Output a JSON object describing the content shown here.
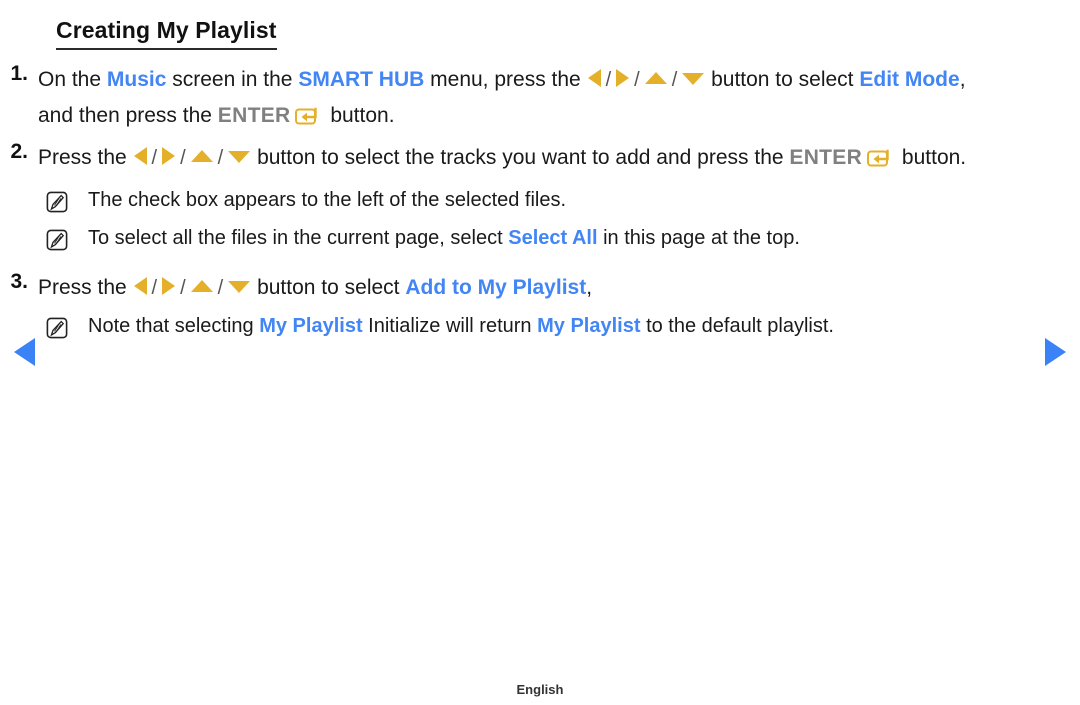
{
  "page": {
    "title": "Creating My Playlist",
    "language_footer": "English"
  },
  "nav": {
    "prev_label": "previous-page",
    "next_label": "next-page"
  },
  "icons": {
    "dpad_left": "arrow-left-icon",
    "dpad_right": "arrow-right-icon",
    "dpad_up": "arrow-up-icon",
    "dpad_down": "arrow-down-icon",
    "enter_key": "enter-key-icon",
    "note": "note-pencil-icon",
    "nav_prev": "nav-prev-arrow-icon",
    "nav_next": "nav-next-arrow-icon"
  },
  "colors": {
    "accent_blue": "#4285f4",
    "nav_blue": "#3b82f6",
    "amber": "#e4b02a",
    "gray_label": "#808080",
    "body_text": "#1a1a1a"
  },
  "steps": [
    {
      "number": "1.",
      "segments": [
        {
          "type": "text",
          "value": "On the "
        },
        {
          "type": "blue",
          "value": "Music"
        },
        {
          "type": "text",
          "value": " screen in the "
        },
        {
          "type": "blue",
          "value": "SMART HUB"
        },
        {
          "type": "text",
          "value": " menu, press the "
        },
        {
          "type": "dpad-group",
          "value": "◀ / ▶ / ▲ / ▼"
        },
        {
          "type": "text",
          "value": " button to select "
        },
        {
          "type": "blue",
          "value": "Edit Mode"
        },
        {
          "type": "text",
          "value": ", and then press the "
        },
        {
          "type": "gray",
          "value": "ENTER"
        },
        {
          "type": "enter-key",
          "value": "enter-key-icon"
        },
        {
          "type": "text",
          "value": " button."
        }
      ]
    },
    {
      "number": "2.",
      "segments": [
        {
          "type": "text",
          "value": "Press the "
        },
        {
          "type": "dpad-group",
          "value": "◀ / ▶ / ▲ / ▼"
        },
        {
          "type": "text",
          "value": " button to select the tracks you want to add and press the "
        },
        {
          "type": "gray",
          "value": "ENTER"
        },
        {
          "type": "enter-key",
          "value": "enter-key-icon"
        },
        {
          "type": "text",
          "value": " button."
        }
      ],
      "notes": [
        {
          "segments": [
            {
              "type": "text",
              "value": "The check box appears to the left of the selected files."
            }
          ]
        },
        {
          "segments": [
            {
              "type": "text",
              "value": "To select all the files in the current page, select "
            },
            {
              "type": "blue",
              "value": "Select All"
            },
            {
              "type": "text",
              "value": " in this page at the top."
            }
          ]
        }
      ]
    },
    {
      "number": "3.",
      "segments": [
        {
          "type": "text",
          "value": "Press the "
        },
        {
          "type": "dpad-group",
          "value": "◀ / ▶ / ▲ / ▼"
        },
        {
          "type": "text",
          "value": " button to select "
        },
        {
          "type": "blue",
          "value": "Add to My Playlist"
        },
        {
          "type": "text",
          "value": ","
        }
      ],
      "notes": [
        {
          "segments": [
            {
              "type": "text",
              "value": "Note that selecting "
            },
            {
              "type": "blue",
              "value": "My Playlist"
            },
            {
              "type": "text",
              "value": " Initialize will return "
            },
            {
              "type": "blue",
              "value": "My Playlist"
            },
            {
              "type": "text",
              "value": " to the default playlist."
            }
          ]
        }
      ]
    }
  ],
  "step_text": {
    "s1_a": "On the ",
    "s1_music": "Music",
    "s1_b": " screen in the ",
    "s1_hub": "SMART HUB",
    "s1_c": " menu, press the ",
    "s1_d": " button to select ",
    "s1_editmode": "Edit Mode",
    "s1_e": ", and then press the ",
    "s1_enter": "ENTER",
    "s1_f": " button.",
    "s2_a": "Press the ",
    "s2_b": " button to select the tracks you want to add and press the ",
    "s2_enter": "ENTER",
    "s2_c": " button.",
    "s2_n1": "The check box appears to the left of the selected files.",
    "s2_n2_a": "To select all the files in the current page, select ",
    "s2_n2_selectall": "Select All",
    "s2_n2_b": " in this page at the top.",
    "s3_a": "Press the ",
    "s3_b": " button to select ",
    "s3_addto": "Add to My Playlist",
    "s3_c": ",",
    "s3_n1_a": "Note that selecting ",
    "s3_n1_myplaylist1": "My Playlist",
    "s3_n1_b": " Initialize will return ",
    "s3_n1_myplaylist2": "My Playlist",
    "s3_n1_c": " to the default playlist."
  },
  "symbols": {
    "slash": "/"
  }
}
